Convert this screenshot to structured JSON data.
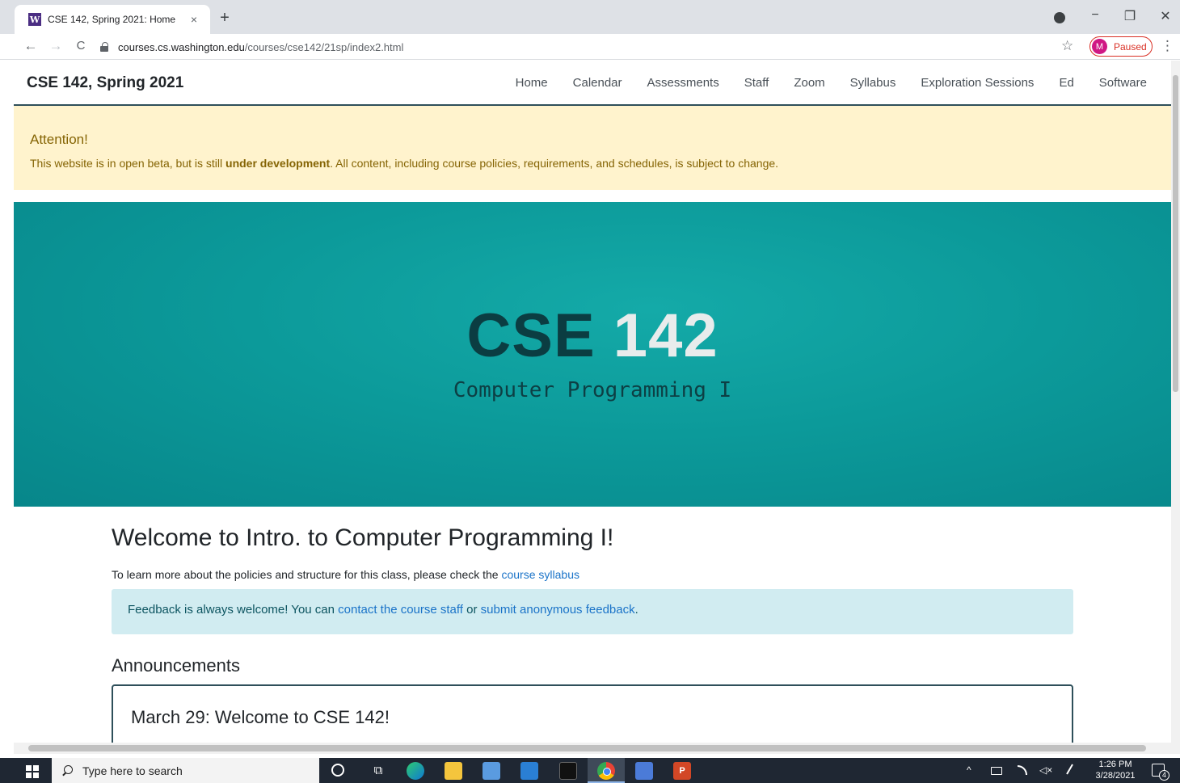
{
  "browser": {
    "tab_title": "CSE 142, Spring 2021: Home",
    "favicon_letter": "W",
    "tab_close": "×",
    "new_tab": "+",
    "window_controls": {
      "minimize": "−",
      "restore": "❐",
      "close": "✕"
    },
    "nav": {
      "back": "←",
      "forward": "→",
      "reload": "C"
    },
    "url_host": "courses.cs.washington.edu",
    "url_path": "/courses/cse142/21sp/index2.html",
    "bookmark_star": "☆",
    "profile_initial": "M",
    "profile_status": "Paused",
    "menu": "⋮"
  },
  "site": {
    "brand": "CSE 142, Spring 2021",
    "nav_items": [
      "Home",
      "Calendar",
      "Assessments",
      "Staff",
      "Zoom",
      "Syllabus",
      "Exploration Sessions",
      "Ed",
      "Software"
    ],
    "attention": {
      "heading": "Attention!",
      "text_before": "This website is in open beta, but is still ",
      "text_bold": "under development",
      "text_after": ". All content, including course policies, requirements, and schedules, is subject to change."
    },
    "hero": {
      "title_part1": "CSE",
      "title_part2": "142",
      "subtitle": "Computer Programming I"
    },
    "welcome": {
      "title": "Welcome to Intro. to Computer Programming I!",
      "intro_text": "To learn more about the policies and structure for this class, please check the ",
      "intro_link": "course syllabus",
      "feedback_before": "Feedback is always welcome! You can ",
      "feedback_link1": "contact the course staff",
      "feedback_middle": " or ",
      "feedback_link2": "submit anonymous feedback",
      "feedback_after": "."
    },
    "announcements": {
      "heading": "Announcements",
      "items": [
        {
          "title": "March 29: Welcome to CSE 142!"
        }
      ]
    },
    "colors": {
      "hero_teal": "#0c9a9a",
      "accent_dark": "#2e4f5a",
      "link": "#1a73c8",
      "warning_bg": "#fff3cd",
      "info_bg": "#d1ecf1"
    }
  },
  "taskbar": {
    "search_placeholder": "Type here to search",
    "taskview_glyph": "⧉",
    "ppt_label": "P",
    "tray": {
      "chevron": "^",
      "volume": "◁×"
    },
    "time": "1:26 PM",
    "date": "3/28/2021",
    "notification_count": "4",
    "apps": [
      "cortana-icon",
      "task-view-icon",
      "edge-icon",
      "file-explorer-icon",
      "store-icon",
      "mail-icon",
      "terminal-icon",
      "chrome-icon",
      "snip-icon",
      "powerpoint-icon"
    ]
  }
}
